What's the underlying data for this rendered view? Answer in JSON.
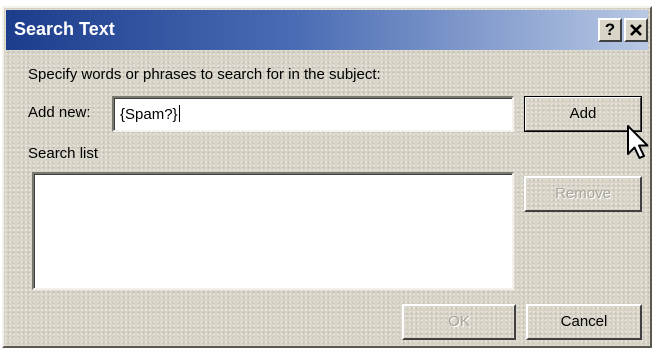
{
  "window": {
    "title": "Search Text",
    "help_label": "?",
    "close_label": "✕"
  },
  "form": {
    "instruction": "Specify words or phrases to search for in the subject:",
    "add_new_label": "Add new:",
    "add_new_value": "{Spam?}",
    "search_list_label": "Search list",
    "search_list_items": []
  },
  "buttons": {
    "add": "Add",
    "remove": "Remove",
    "ok": "OK",
    "cancel": "Cancel"
  },
  "colors": {
    "titlebar_start": "#1c3d8c",
    "titlebar_end": "#b8c8e4",
    "dialog_face": "#d8d4c8"
  },
  "icons": {
    "pointer": "mouse-pointer-icon"
  }
}
